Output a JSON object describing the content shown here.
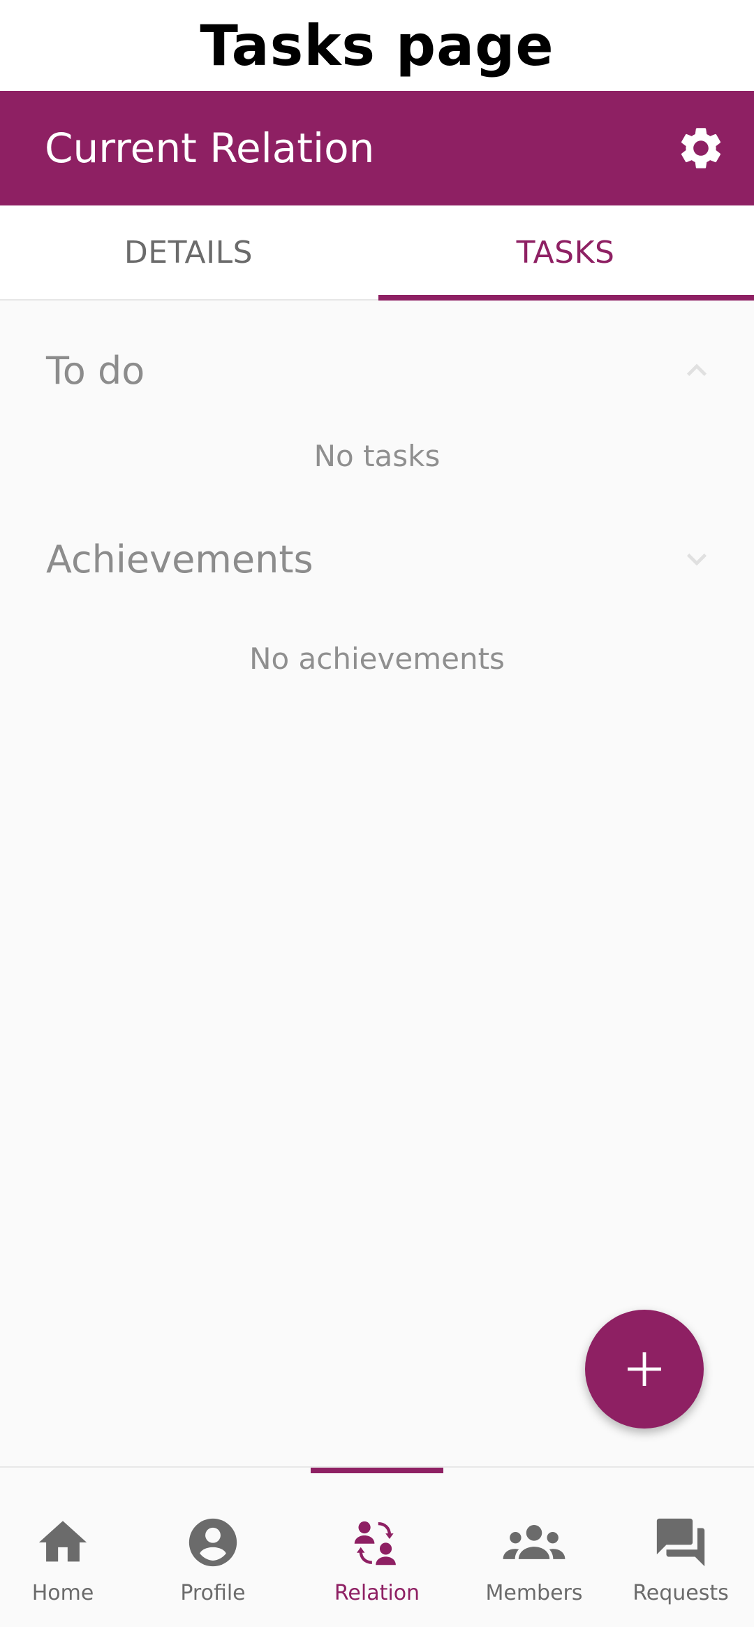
{
  "caption": "Tasks page",
  "app_bar": {
    "title": "Current Relation",
    "settings_icon": "gear-icon"
  },
  "tabs": [
    {
      "label": "DETAILS",
      "active": false
    },
    {
      "label": "TASKS",
      "active": true
    }
  ],
  "sections": {
    "todo": {
      "title": "To do",
      "expanded": true,
      "empty_text": "No tasks"
    },
    "achievements": {
      "title": "Achievements",
      "expanded": false,
      "empty_text": "No achievements"
    }
  },
  "fab": {
    "icon": "plus-icon"
  },
  "bottom_nav": {
    "active": "Relation",
    "items": [
      {
        "label": "Home",
        "icon": "home-icon"
      },
      {
        "label": "Profile",
        "icon": "profile-icon"
      },
      {
        "label": "Relation",
        "icon": "relation-icon"
      },
      {
        "label": "Members",
        "icon": "members-icon"
      },
      {
        "label": "Requests",
        "icon": "requests-icon"
      }
    ]
  },
  "colors": {
    "primary": "#8e2063",
    "background": "#fafafa",
    "muted_text": "#8c8c8c",
    "icon_gray": "#6b6b6b"
  }
}
